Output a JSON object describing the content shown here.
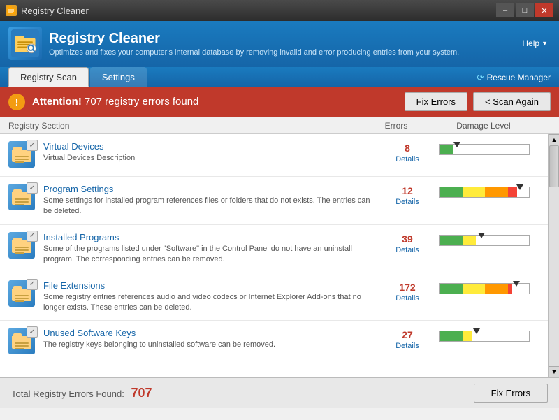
{
  "titleBar": {
    "title": "Registry Cleaner",
    "icon": "🔧",
    "minimize": "–",
    "maximize": "□",
    "close": "✕"
  },
  "header": {
    "title": "Registry Cleaner",
    "description": "Optimizes and fixes your computer's internal database by removing invalid and error producing entries from your system.",
    "helpLabel": "Help",
    "appIcon": "🗂"
  },
  "tabs": [
    {
      "id": "registry-scan",
      "label": "Registry Scan",
      "active": true
    },
    {
      "id": "settings",
      "label": "Settings",
      "active": false
    }
  ],
  "rescueManager": {
    "label": "Rescue Manager"
  },
  "alertBanner": {
    "icon": "!",
    "attentionLabel": "Attention!",
    "message": "707 registry errors found",
    "fixErrorsLabel": "Fix Errors",
    "scanAgainLabel": "< Scan Again"
  },
  "tableHeaders": {
    "section": "Registry Section",
    "errors": "Errors",
    "damage": "Damage Level"
  },
  "registryItems": [
    {
      "id": "virtual-devices",
      "title": "Virtual Devices",
      "description": "Virtual Devices Description",
      "errors": 8,
      "detailsLabel": "Details",
      "damagePercent": 15,
      "arrowPos": 20
    },
    {
      "id": "program-settings",
      "title": "Program Settings",
      "description": "Some settings for installed program references files or folders that do not exists. The entries can be deleted.",
      "errors": 12,
      "detailsLabel": "Details",
      "damagePercent": 85,
      "arrowPos": 110
    },
    {
      "id": "installed-programs",
      "title": "Installed Programs",
      "description": "Some of the programs listed under \"Software\" in the Control Panel do not have an uninstall program. The corresponding entries can be removed.",
      "errors": 39,
      "detailsLabel": "Details",
      "damagePercent": 40,
      "arrowPos": 55
    },
    {
      "id": "file-extensions",
      "title": "File Extensions",
      "description": "Some registry entries references audio and video codecs or Internet Explorer Add-ons that no longer exists. These entries can be deleted.",
      "errors": 172,
      "detailsLabel": "Details",
      "damagePercent": 80,
      "arrowPos": 105
    },
    {
      "id": "unused-software",
      "title": "Unused Software Keys",
      "description": "The registry keys belonging to uninstalled software can be removed.",
      "errors": 27,
      "detailsLabel": "Details",
      "damagePercent": 35,
      "arrowPos": 48
    }
  ],
  "footer": {
    "label": "Total Registry Errors Found:",
    "count": "707",
    "fixErrorsLabel": "Fix Errors"
  }
}
